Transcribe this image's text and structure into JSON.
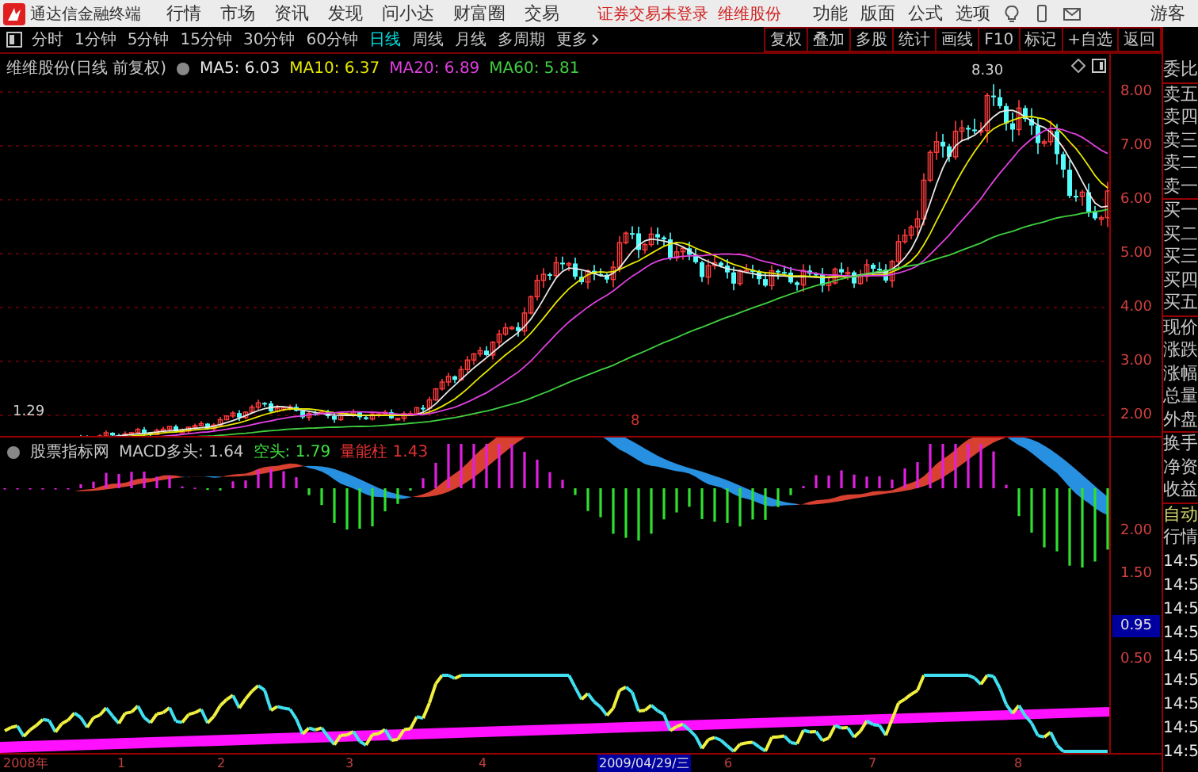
{
  "menubar": {
    "app_title": "通达信金融终端",
    "menus": [
      "行情",
      "市场",
      "资讯",
      "发现",
      "问小达",
      "财富圈",
      "交易"
    ],
    "login_status": "证券交易未登录",
    "stock_name": "维维股份",
    "right_menus": [
      "功能",
      "版面",
      "公式",
      "选项"
    ],
    "user": "游客"
  },
  "toolbar": {
    "periods": [
      {
        "label": "分时",
        "selected": false
      },
      {
        "label": "1分钟",
        "selected": false
      },
      {
        "label": "5分钟",
        "selected": false
      },
      {
        "label": "15分钟",
        "selected": false
      },
      {
        "label": "30分钟",
        "selected": false
      },
      {
        "label": "60分钟",
        "selected": false
      },
      {
        "label": "日线",
        "selected": true
      },
      {
        "label": "周线",
        "selected": false
      },
      {
        "label": "月线",
        "selected": false
      },
      {
        "label": "多周期",
        "selected": false
      }
    ],
    "more": "更多",
    "actions": [
      "复权",
      "叠加",
      "多股",
      "统计",
      "画线",
      "F10",
      "标记",
      "+自选",
      "返回"
    ]
  },
  "price_panel": {
    "title": "维维股份(日线 前复权)",
    "indicators": [
      {
        "label": "MA5: 6.03",
        "color": "#e8e8e8"
      },
      {
        "label": "MA10: 6.37",
        "color": "#e8e800"
      },
      {
        "label": "MA20: 6.89",
        "color": "#e040e0"
      },
      {
        "label": "MA60: 5.81",
        "color": "#40d040"
      }
    ],
    "high_label": "8.30",
    "low_label": "1.29",
    "marker": "8",
    "y_axis": [
      "8.00",
      "7.00",
      "6.00",
      "5.00",
      "4.00",
      "3.00",
      "2.00"
    ]
  },
  "indicator_panel": {
    "title": "股票指标网",
    "values": [
      {
        "label": "MACD多头: 1.64",
        "color": "#c8c8c8"
      },
      {
        "label": "空头: 1.79",
        "color": "#40e040"
      },
      {
        "label": "量能柱 1.43",
        "color": "#e03030"
      }
    ],
    "y_axis": [
      {
        "label": "2.00",
        "kind": "tick"
      },
      {
        "label": "1.50",
        "kind": "tick"
      },
      {
        "label": "0.95",
        "kind": "cursor"
      },
      {
        "label": "0.50",
        "kind": "tick"
      }
    ]
  },
  "x_axis": [
    {
      "label": "2008年",
      "kind": "tick"
    },
    {
      "label": "1",
      "kind": "tick"
    },
    {
      "label": "2",
      "kind": "tick"
    },
    {
      "label": "3",
      "kind": "tick"
    },
    {
      "label": "4",
      "kind": "tick"
    },
    {
      "label": "2009/04/29/三",
      "kind": "cursor"
    },
    {
      "label": "6",
      "kind": "tick"
    },
    {
      "label": "7",
      "kind": "tick"
    },
    {
      "label": "8",
      "kind": "tick"
    }
  ],
  "quote_panel": {
    "groups": [
      [
        "委比"
      ],
      [
        "卖五",
        "卖四",
        "卖三",
        "卖二",
        "卖一"
      ],
      [
        "买一",
        "买二",
        "买三",
        "买四",
        "买五"
      ],
      [
        "现价",
        "涨跌",
        "涨幅",
        "总量",
        "外盘"
      ],
      [
        "换手",
        "净资",
        "收益"
      ]
    ],
    "auto_label": "自动",
    "feed_label": "行情",
    "times": [
      "14:5",
      "14:5",
      "14:5",
      "14:5",
      "14:5",
      "14:5",
      "14:5",
      "14:5",
      "14:5"
    ]
  }
}
